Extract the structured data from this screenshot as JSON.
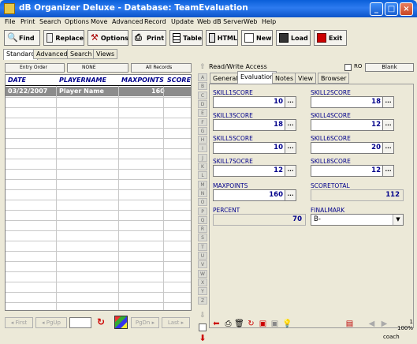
{
  "window": {
    "title": "dB Organizer Deluxe - Database: TeamEvaluation"
  },
  "menu": [
    "File",
    "Print",
    "Search",
    "Options",
    "Move",
    "Advanced",
    "Record",
    "Update",
    "Web dB Server",
    "Web",
    "Help"
  ],
  "toolbar": {
    "find": "Find",
    "replace": "Replace",
    "options": "Options",
    "print": "Print",
    "table": "Table",
    "html": "HTML",
    "new": "New",
    "load": "Load",
    "exit": "Exit"
  },
  "left_tabs": [
    "Standard",
    "Advanced",
    "Search",
    "Views"
  ],
  "order_bar": {
    "entry_order": "Entry Order",
    "none": "NONE",
    "all_records": "All Records"
  },
  "grid": {
    "columns": [
      "DATE",
      "PLAYERNAME",
      "MAXPOINTS",
      "SCORET"
    ],
    "selected_row": {
      "date": "03/22/2007",
      "player": "Player Name",
      "maxpoints": "160"
    }
  },
  "nav": {
    "first": "First",
    "pgup": "PgUp",
    "pgdn": "PgDn",
    "last": "Last"
  },
  "alphabet": [
    "A",
    "B",
    "C",
    "D",
    "E",
    "F",
    "G",
    "H",
    "I",
    "J",
    "K",
    "L",
    "M",
    "N",
    "O",
    "P",
    "Q",
    "R",
    "S",
    "T",
    "U",
    "V",
    "W",
    "X",
    "Y",
    "Z"
  ],
  "right": {
    "access": "Read/Write Access",
    "ro_label": "RO",
    "blank_label": "Blank",
    "tabs": [
      "General",
      "Evaluation",
      "Notes",
      "View",
      "Browser"
    ],
    "fields": {
      "skill1": {
        "label": "SKILL1SCORE",
        "value": "10"
      },
      "skill2": {
        "label": "SKILL2SCORE",
        "value": "18"
      },
      "skill3": {
        "label": "SKILL3SCORE",
        "value": "18"
      },
      "skill4": {
        "label": "SKILL4SCORE",
        "value": "12"
      },
      "skill5": {
        "label": "SKILL5SCORE",
        "value": "10"
      },
      "skill6": {
        "label": "SKILL6SCORE",
        "value": "20"
      },
      "skill7": {
        "label": "SKILL7SOCRE",
        "value": "12"
      },
      "skill8": {
        "label": "SKILL8SCORE",
        "value": "12"
      },
      "maxpoints": {
        "label": "MAXPOINTS",
        "value": "160"
      },
      "scoretotal": {
        "label": "SCORETOTAL",
        "value": "112"
      },
      "percent": {
        "label": "PERCENT",
        "value": "70"
      },
      "finalmark": {
        "label": "FINALMARK",
        "value": "B-"
      }
    },
    "dots": "..."
  },
  "status": {
    "zoom_top": "1",
    "zoom": "100%",
    "user": "coach"
  },
  "colors": {
    "title_bar": "#0a5fd9",
    "field_text": "#00008b",
    "selected_row": "#8c8c8c"
  }
}
